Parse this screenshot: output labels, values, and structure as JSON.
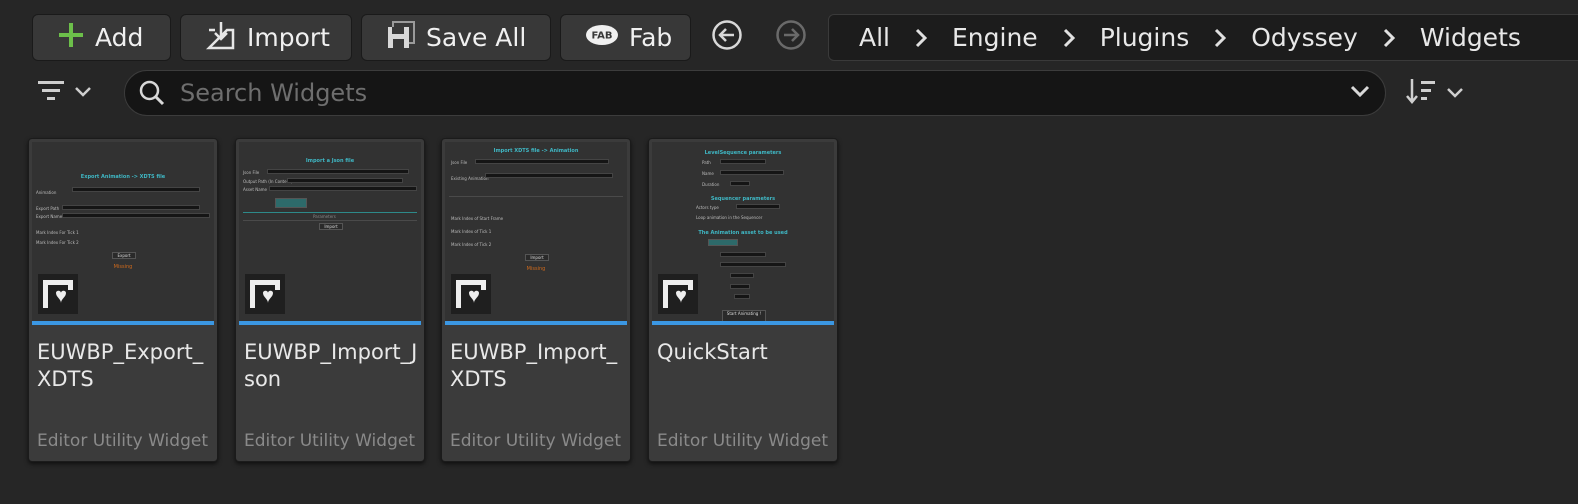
{
  "toolbar": {
    "add_label": "Add",
    "import_label": "Import",
    "save_all_label": "Save All",
    "fab_label": "Fab",
    "fab_logo_text": "FAB"
  },
  "breadcrumb": [
    "All",
    "Engine",
    "Plugins",
    "Odyssey",
    "Widgets"
  ],
  "search": {
    "placeholder": "Search Widgets"
  },
  "colors": {
    "accent_green": "#6cbf4a",
    "thumbnail_bar": "#3b97e3",
    "title_cyan": "#3fb7c4",
    "warning_orange": "#d06a1c"
  },
  "assets": [
    {
      "name": "EUWBP_Export_XDTS",
      "type": "Editor Utility Widget",
      "preview": {
        "title": "Export Animation -> XDTS file",
        "labels": [
          "Animation",
          "Export Path",
          "Export Name",
          "Mark Index For Tick 1",
          "Mark Index For Tick 2"
        ],
        "button": "Export",
        "status": "Missing"
      }
    },
    {
      "name": "EUWBP_Import_Json",
      "type": "Editor Utility Widget",
      "preview": {
        "title": "Import a Json file",
        "labels": [
          "Json File",
          "Output Path (In Content)",
          "Asset Name"
        ],
        "button": "Import",
        "status": "Parameters"
      }
    },
    {
      "name": "EUWBP_Import_XDTS",
      "type": "Editor Utility Widget",
      "preview": {
        "title": "Import XDTS file -> Animation",
        "labels": [
          "Json File",
          "Existing Animation",
          "Mark Index of Start Frame",
          "Mark Index of Tick 1",
          "Mark Index of Tick 2"
        ],
        "button": "Import",
        "status": "Missing"
      }
    },
    {
      "name": "QuickStart",
      "type": "Editor Utility Widget",
      "preview": {
        "title": "LevelSequence parameters",
        "labels": [
          "Path",
          "Name",
          "Duration",
          "Actors type",
          "Loop animation in the Sequencer"
        ],
        "section": "Sequencer parameters",
        "section2": "The Animation asset to be used",
        "button": "Start Animating !",
        "status": ""
      }
    }
  ]
}
